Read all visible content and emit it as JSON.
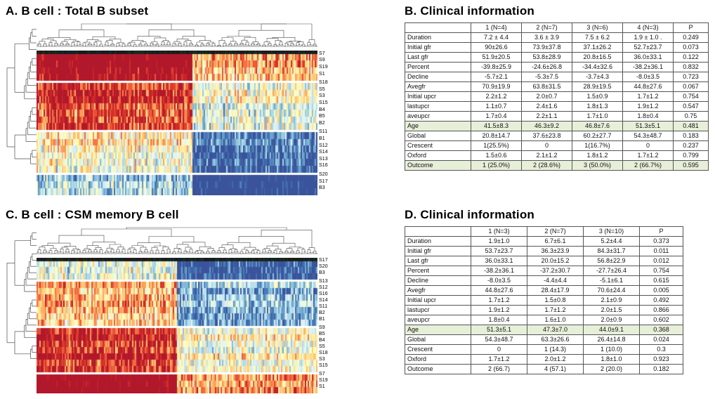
{
  "figure": {
    "panels": [
      "A",
      "B",
      "C",
      "D"
    ]
  },
  "panelA": {
    "title": "A. B cell : Total B subset",
    "row_labels": [
      "S7",
      "S9",
      "S19",
      "S1",
      "S18",
      "S5",
      "S3",
      "S15",
      "B4",
      "B5",
      "B2",
      "S11",
      "B1",
      "S12",
      "S14",
      "S13",
      "S16",
      "S20",
      "S17",
      "B3"
    ],
    "row_clusters": [
      {
        "rows": 4,
        "gap": true
      },
      {
        "rows": 7,
        "gap": true
      },
      {
        "rows": 6,
        "gap": true
      },
      {
        "rows": 3,
        "gap": false
      }
    ],
    "n_columns": 200,
    "colormap": [
      "#3a539b",
      "#4575b4",
      "#74add1",
      "#abd9e9",
      "#e0f3f8",
      "#ffffbf",
      "#fee090",
      "#fdae61",
      "#f46d43",
      "#d73027",
      "#b2182b"
    ],
    "colorbar_strip": true
  },
  "panelC": {
    "title": "C. B cell : CSM memory B cell",
    "row_labels": [
      "S17",
      "S20",
      "B3",
      "S13",
      "S12",
      "S16",
      "S14",
      "S11",
      "B2",
      "B1",
      "S9",
      "B5",
      "B4",
      "S5",
      "S18",
      "S3",
      "S15",
      "S7",
      "S19",
      "S1"
    ],
    "row_clusters": [
      {
        "rows": 3,
        "gap": true
      },
      {
        "rows": 7,
        "gap": true
      },
      {
        "rows": 7,
        "gap": true
      },
      {
        "rows": 3,
        "gap": false
      }
    ],
    "n_columns": 200,
    "colormap": [
      "#3a539b",
      "#4575b4",
      "#74add1",
      "#abd9e9",
      "#e0f3f8",
      "#ffffbf",
      "#fee090",
      "#fdae61",
      "#f46d43",
      "#d73027",
      "#b2182b"
    ],
    "colorbar_strip": true
  },
  "panelB": {
    "title": "B. Clinical information",
    "headers": [
      "",
      "1 (N=4)",
      "2 (N=7)",
      "3 (N=6)",
      "4 (N=3)",
      "P"
    ],
    "rows": [
      {
        "label": "Duration",
        "cells": [
          "7.2 ± 4.4",
          "3.6 ± 3.9",
          "7.5 ± 6.2",
          "1.9 ± 1.0 .",
          "0.249"
        ],
        "highlight": false
      },
      {
        "label": "Initial gfr",
        "cells": [
          "90±26.6",
          "73.9±37.8",
          "37.1±26.2",
          "52.7±23.7",
          "0.073"
        ],
        "highlight": false
      },
      {
        "label": "Last gfr",
        "cells": [
          "51.9±20.5",
          "53.8±28.9",
          "20.8±16.5",
          "36.0±33.1",
          "0.122"
        ],
        "highlight": false
      },
      {
        "label": "Percent",
        "cells": [
          "-39.8±25.9",
          "-24.6±26.8",
          "-34.4±32.6",
          "-38.2±36.1",
          "0.832"
        ],
        "highlight": false
      },
      {
        "label": "Decline",
        "cells": [
          "-5.7±2.1",
          "-5.3±7.5",
          "-3.7±4.3",
          "-8.0±3.5",
          "0.723"
        ],
        "highlight": false
      },
      {
        "label": "Avegfr",
        "cells": [
          "70.9±19.9",
          "63.8±31.5",
          "28.9±19.5",
          "44.8±27.6",
          "0.067"
        ],
        "highlight": false
      },
      {
        "label": "Initial upcr",
        "cells": [
          "2.2±1.2",
          "2.0±0.7",
          "1.5±0.9",
          "1.7±1.2",
          "0.754"
        ],
        "highlight": false
      },
      {
        "label": "lastupcr",
        "cells": [
          "1.1±0.7",
          "2.4±1.6",
          "1.8±1.3",
          "1.9±1.2",
          "0.547"
        ],
        "highlight": false
      },
      {
        "label": "aveupcr",
        "cells": [
          "1.7±0.4",
          "2.2±1.1",
          "1.7±1.0",
          "1.8±0.4",
          "0.75"
        ],
        "highlight": false
      },
      {
        "label": "Age",
        "cells": [
          "41.5±8.3",
          "46.3±9.2",
          "46.8±7.6",
          "51.3±5.1",
          "0.481"
        ],
        "highlight": true
      },
      {
        "label": "Global",
        "cells": [
          "20.8±14.7",
          "37.6±23.8",
          "60.2±27.7",
          "54.3±48.7",
          "0.183"
        ],
        "highlight": false
      },
      {
        "label": "Crescent",
        "cells": [
          "1(25.5%)",
          "0",
          "1(16.7%)",
          "0",
          "0.237"
        ],
        "highlight": false
      },
      {
        "label": "Oxford",
        "cells": [
          "1.5±0.6",
          "2.1±1.2",
          "1.8±1.2",
          "1.7±1.2",
          "0.799"
        ],
        "highlight": false
      },
      {
        "label": "Outcome",
        "cells": [
          "1 (25.0%)",
          "2 (28.6%)",
          "3 (50.0%)",
          "2 (66.7%)",
          "0.595"
        ],
        "highlight": true
      }
    ]
  },
  "panelD": {
    "title": "D. Clinical information",
    "headers": [
      "",
      "1 (N=3)",
      "2 (N=7)",
      "3 (N=10)",
      "P"
    ],
    "rows": [
      {
        "label": "Duration",
        "cells": [
          "1.9±1.0",
          "6.7±6.1",
          "5.2±4.4",
          "0.373"
        ],
        "highlight": false
      },
      {
        "label": "Initial gfr",
        "cells": [
          "53.7±23.7",
          "36.3±23.9",
          "84.3±31.7",
          "0.011"
        ],
        "highlight": false
      },
      {
        "label": "Last gfr",
        "cells": [
          "36.0±33.1",
          "20.0±15.2",
          "56.8±22.9",
          "0.012"
        ],
        "highlight": false
      },
      {
        "label": "Percent",
        "cells": [
          "-38.2±36.1",
          "-37.2±30.7",
          "-27.7±26.4",
          "0.754"
        ],
        "highlight": false
      },
      {
        "label": "Decline",
        "cells": [
          "-8.0±3.5",
          "-4.4±4.4",
          "-5.1±6.1",
          "0.615"
        ],
        "highlight": false
      },
      {
        "label": "Avegfr",
        "cells": [
          "44.8±27.6",
          "28.4±17.9",
          "70.6±24.4",
          "0.005"
        ],
        "highlight": false
      },
      {
        "label": "Initial upcr",
        "cells": [
          "1.7±1.2",
          "1.5±0.8",
          "2.1±0.9",
          "0.492"
        ],
        "highlight": false
      },
      {
        "label": "lastupcr",
        "cells": [
          "1.9±1.2",
          "1.7±1.2",
          "2.0±1.5",
          "0.866"
        ],
        "highlight": false
      },
      {
        "label": "aveupcr",
        "cells": [
          "1.8±0.4",
          "1.6±1.0",
          "2.0±0.9",
          "0.602"
        ],
        "highlight": false
      },
      {
        "label": "Age",
        "cells": [
          "51.3±5.1",
          "47.3±7.0",
          "44.0±9.1",
          "0.368"
        ],
        "highlight": true
      },
      {
        "label": "Global",
        "cells": [
          "54.3±48.7",
          "63.3±26.6",
          "26.4±14.8",
          "0.024"
        ],
        "highlight": false
      },
      {
        "label": "Crescent",
        "cells": [
          "0",
          "1 (14.3)",
          "1 (10.0)",
          "0.3"
        ],
        "highlight": false
      },
      {
        "label": "Oxford",
        "cells": [
          "1.7±1.2",
          "2.0±1.2",
          "1.8±1.0",
          "0.923"
        ],
        "highlight": false
      },
      {
        "label": "Outcome",
        "cells": [
          "2 (66.7)",
          "4 (57.1)",
          "2 (20.0)",
          "0.182"
        ],
        "highlight": false
      }
    ]
  },
  "colors": {
    "highlight_row": "#e7efd9",
    "table_border": "#555555",
    "text": "#000000",
    "dendrogram": "#4a4a4a"
  }
}
